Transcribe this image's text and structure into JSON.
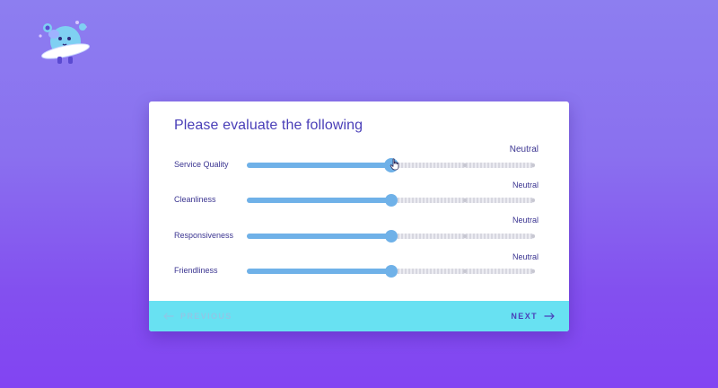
{
  "survey": {
    "title": "Please evaluate the following",
    "rows": [
      {
        "label": "Service Quality",
        "value_label": "Neutral",
        "value_fraction": 0.5
      },
      {
        "label": "Cleanliness",
        "value_label": "Neutral",
        "value_fraction": 0.5
      },
      {
        "label": "Responsiveness",
        "value_label": "Neutral",
        "value_fraction": 0.5
      },
      {
        "label": "Friendliness",
        "value_label": "Neutral",
        "value_fraction": 0.5
      }
    ],
    "scale_steps": 5
  },
  "footer": {
    "previous_label": "PREVIOUS",
    "next_label": "NEXT"
  },
  "icons": {
    "mascot": "planet-mascot-icon",
    "cursor": "hand-pointer-icon",
    "previous": "arrow-left-icon",
    "next": "arrow-right-icon"
  },
  "colors": {
    "background_top": "#8d7ef0",
    "background_bottom": "#8244f2",
    "accent_text": "#4a3fb8",
    "slider_fill": "#6fb1e8",
    "footer_background": "#68e1f2",
    "previous_disabled": "#8fc7e6"
  }
}
